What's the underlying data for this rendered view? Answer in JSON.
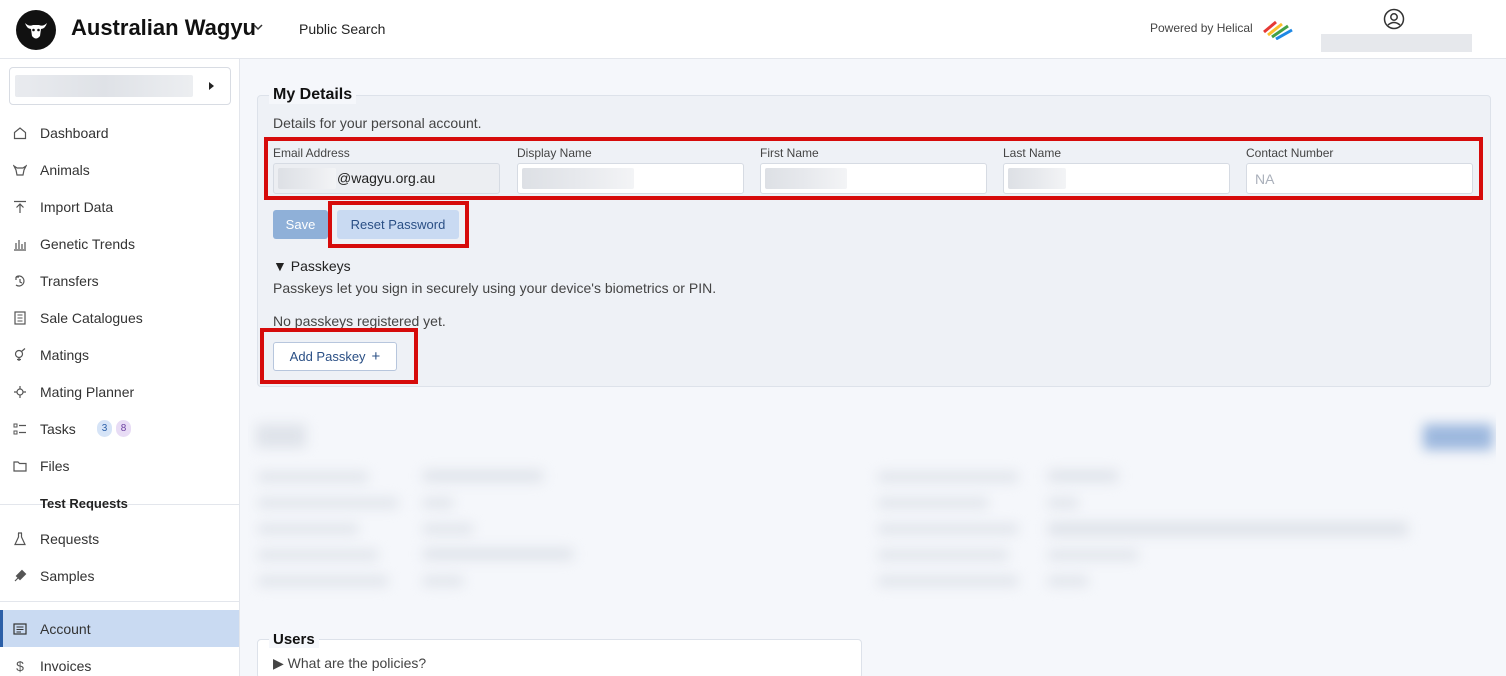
{
  "header": {
    "brand": "Australian Wagyu",
    "public_search": "Public Search",
    "powered_by": "Powered by Helical"
  },
  "sidebar": {
    "items": [
      {
        "label": "Dashboard",
        "icon": "home-icon"
      },
      {
        "label": "Animals",
        "icon": "cow-icon"
      },
      {
        "label": "Import Data",
        "icon": "upload-icon"
      },
      {
        "label": "Genetic Trends",
        "icon": "bar-chart-icon"
      },
      {
        "label": "Transfers",
        "icon": "transfer-icon"
      },
      {
        "label": "Sale Catalogues",
        "icon": "catalogue-icon"
      },
      {
        "label": "Matings",
        "icon": "gender-icon"
      },
      {
        "label": "Mating Planner",
        "icon": "planner-icon"
      },
      {
        "label": "Tasks",
        "icon": "tasks-icon",
        "badges": [
          "3",
          "8"
        ]
      },
      {
        "label": "Files",
        "icon": "folder-icon"
      }
    ],
    "test_requests_heading": "Test Requests",
    "test_items": [
      {
        "label": "Requests",
        "icon": "flask-icon"
      },
      {
        "label": "Samples",
        "icon": "dropper-icon"
      }
    ],
    "account_items": [
      {
        "label": "Account",
        "icon": "account-icon",
        "active": true
      },
      {
        "label": "Invoices",
        "icon": "dollar-icon"
      }
    ]
  },
  "my_details": {
    "title": "My Details",
    "description": "Details for your personal account.",
    "fields": [
      {
        "label": "Email Address",
        "value": "@wagyu.org.au"
      },
      {
        "label": "Display Name",
        "value": ""
      },
      {
        "label": "First Name",
        "value": ""
      },
      {
        "label": "Last Name",
        "value": ""
      },
      {
        "label": "Contact Number",
        "placeholder": "NA"
      }
    ],
    "save_label": "Save",
    "reset_label": "Reset Password",
    "passkeys_heading": "▼ Passkeys",
    "passkeys_description": "Passkeys let you sign in securely using your device's biometrics or PIN.",
    "passkeys_empty": "No passkeys registered yet.",
    "add_passkey_label": "Add Passkey",
    "add_icon": "+"
  },
  "users": {
    "title": "Users",
    "policies": "▶ What are the policies?"
  },
  "colors": {
    "highlight": "#d60b0b",
    "accent": "#2b5fa8",
    "active_bg": "#c9daf2"
  }
}
